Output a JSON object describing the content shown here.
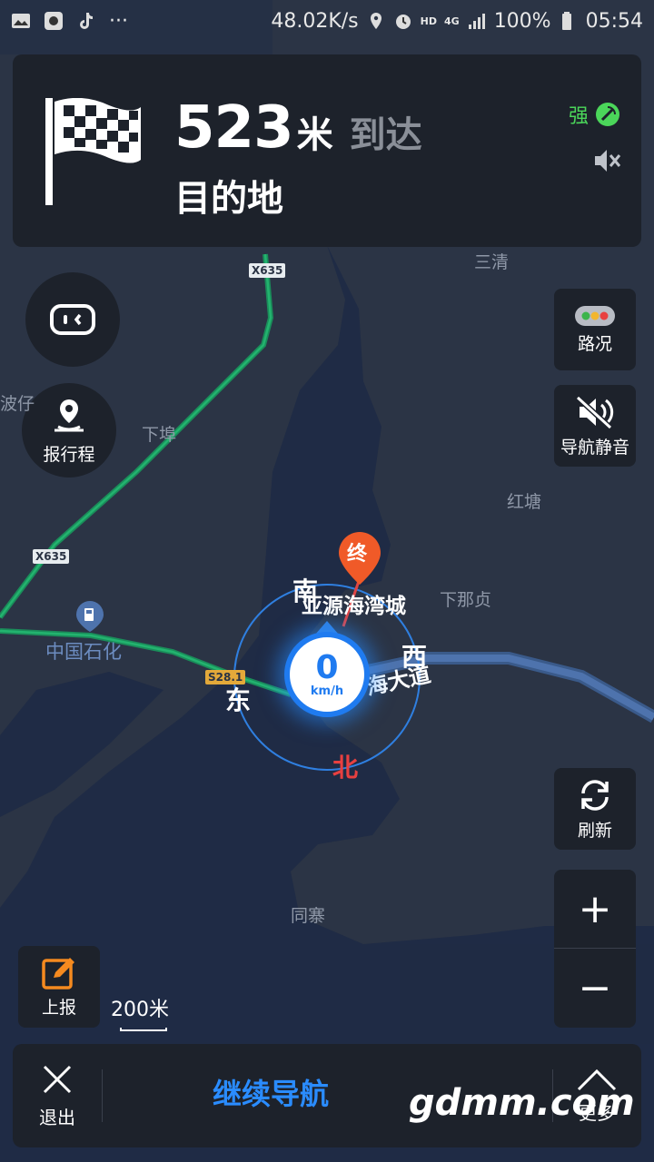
{
  "status_bar": {
    "net_speed": "48.02K/s",
    "hd": "HD",
    "network": "4G",
    "battery": "100%",
    "time": "05:54",
    "dots": "···"
  },
  "nav_card": {
    "distance": "523",
    "distance_unit": "米",
    "arrive_text": "到达",
    "destination": "目的地",
    "gps_strength": "强"
  },
  "left_buttons": {
    "report_trip": "报行程"
  },
  "right_buttons": {
    "traffic": "路况",
    "nav_mute": "导航静音",
    "refresh": "刷新",
    "zoom_in": "+",
    "zoom_out": "−"
  },
  "map_labels": {
    "sanqing": "三清",
    "xiabu": "下埠",
    "bozai": "波仔",
    "hongtang": "红塘",
    "xianazhen": "下那贞",
    "tongzhai": "同寨",
    "sinopec": "中国石化",
    "destination_name": "亚源海湾城",
    "road_name": "海大道",
    "end_marker": "终",
    "road_x635_top": "X635",
    "road_x635_left": "X635",
    "road_s281": "S28.1"
  },
  "compass": {
    "south": "南",
    "north": "北",
    "east": "东",
    "west": "西"
  },
  "speed": {
    "value": "0",
    "unit": "km/h"
  },
  "report": {
    "label": "上报"
  },
  "scale": {
    "label": "200米"
  },
  "bottom_bar": {
    "exit": "退出",
    "continue": "继续导航",
    "more": "更多"
  },
  "watermark": "gdmm.com",
  "colors": {
    "map_bg": "#2a3344",
    "water": "#1e2b44",
    "panel": "#1d222b",
    "accent_blue": "#2a8cff",
    "gps_green": "#4bd65a",
    "road_green": "#1fa86a",
    "marker_orange": "#f05a28",
    "report_orange": "#f58a1f"
  }
}
